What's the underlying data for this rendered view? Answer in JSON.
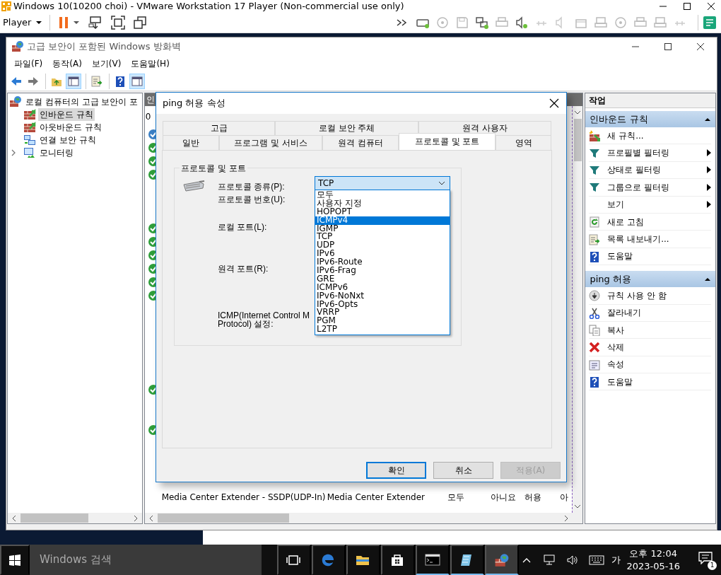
{
  "vmware": {
    "title": "Windows 10(10200 choi) - VMware Workstation 17 Player (Non-commercial use only)",
    "player_menu": "Player"
  },
  "mmc": {
    "title": "고급 보안이 포함된 Windows 방화벽",
    "menu": [
      "파일(F)",
      "동작(A)",
      "보기(V)",
      "도움말(H)"
    ],
    "toolbar": [
      {
        "pressed": false
      },
      {
        "pressed": false
      },
      {
        "pressed": false
      },
      {
        "pressed": true
      },
      {
        "pressed": false
      },
      {
        "pressed": false
      },
      {
        "pressed": true
      }
    ],
    "tree": {
      "label": "로컬 컴퓨터의 고급 보안이 포",
      "children": [
        {
          "label": "인바운드 규칙",
          "selected": true,
          "expandable": false
        },
        {
          "label": "아웃바운드 규칙",
          "selected": false,
          "expandable": false
        },
        {
          "label": "연결 보안 규칙",
          "selected": false,
          "expandable": false
        },
        {
          "label": "모니터링",
          "selected": false,
          "expandable": true
        }
      ]
    },
    "rules": {
      "title": "인",
      "column_1": "0",
      "rows": [
        {
          "kind": "secure"
        },
        {
          "kind": "allowed"
        },
        {
          "kind": "allowed"
        },
        {
          "kind": "allowed"
        },
        {
          "kind": "disabled"
        },
        {
          "kind": "disabled"
        },
        {
          "kind": "disabled"
        },
        {
          "kind": "allowed"
        },
        {
          "kind": "allowed"
        },
        {
          "kind": "allowed"
        },
        {
          "kind": "allowed"
        },
        {
          "kind": "allowed"
        },
        {
          "kind": "allowed"
        },
        {
          "kind": "disabled"
        },
        {
          "kind": "disabled"
        },
        {
          "kind": "disabled"
        },
        {
          "kind": "disabled"
        },
        {
          "kind": "disabled"
        },
        {
          "kind": "disabled"
        },
        {
          "kind": "allowed"
        },
        {
          "kind": "disabled"
        },
        {
          "kind": "disabled"
        },
        {
          "kind": "allowed"
        },
        {
          "kind": "disabled"
        },
        {
          "kind": "disabled"
        },
        {
          "kind": "disabled"
        },
        {
          "kind": "disabled"
        },
        {
          "kind": "disabled",
          "cells": [
            "Media Center Extender - SSDP(UDP-In)",
            "Media Center Extender",
            "모두",
            "아니요",
            "허용",
            "아"
          ]
        },
        {
          "kind": "disabled"
        }
      ]
    },
    "actions": {
      "header": "작업",
      "sections": [
        {
          "title": "인바운드 규칙",
          "items": [
            {
              "label": "새 규칙...",
              "submenu": false
            },
            {
              "label": "프로필별 필터링",
              "submenu": true
            },
            {
              "label": "상태로 필터링",
              "submenu": true
            },
            {
              "label": "그룹으로 필터링",
              "submenu": true
            },
            {
              "label": "보기",
              "submenu": true
            },
            {
              "label": "새로 고침",
              "submenu": false
            },
            {
              "label": "목록 내보내기...",
              "submenu": false
            },
            {
              "label": "도움말",
              "submenu": false
            }
          ]
        },
        {
          "title": "ping 허용",
          "items": [
            {
              "label": "규칙 사용 안 함",
              "submenu": false
            },
            {
              "label": "잘라내기",
              "submenu": false
            },
            {
              "label": "복사",
              "submenu": false
            },
            {
              "label": "삭제",
              "submenu": false
            },
            {
              "label": "속성",
              "submenu": false
            },
            {
              "label": "도움말",
              "submenu": false
            }
          ]
        }
      ]
    }
  },
  "dialog": {
    "title": "ping 허용 속성",
    "tabs_back": [
      {
        "label": "고급",
        "selected": false
      },
      {
        "label": "로컬 보안 주체",
        "selected": false
      },
      {
        "label": "원격 사용자",
        "selected": false
      }
    ],
    "tabs_front": [
      {
        "label": "일반",
        "selected": false
      },
      {
        "label": "프로그램 및 서비스",
        "selected": false
      },
      {
        "label": "원격 컴퓨터",
        "selected": false
      },
      {
        "label": "프로토콜 및 포트",
        "selected": true
      },
      {
        "label": "영역",
        "selected": false
      }
    ],
    "group": "프로토콜 및 포트",
    "labels": [
      "프로토콜 종류(P):",
      "프로토콜 번호(U):",
      "로컬 포트(L):",
      "원격 포트(R):"
    ],
    "icmp_label": [
      "ICMP(Internet Control M",
      "Protocol) 설정:"
    ],
    "protocol_value": "TCP",
    "options": [
      {
        "label": "모두",
        "selected": false
      },
      {
        "label": "사용자 지정",
        "selected": false
      },
      {
        "label": "HOPOPT",
        "selected": false
      },
      {
        "label": "ICMPv4",
        "selected": true
      },
      {
        "label": "IGMP",
        "selected": false
      },
      {
        "label": "TCP",
        "selected": false
      },
      {
        "label": "UDP",
        "selected": false
      },
      {
        "label": "IPv6",
        "selected": false
      },
      {
        "label": "IPv6-Route",
        "selected": false
      },
      {
        "label": "IPv6-Frag",
        "selected": false
      },
      {
        "label": "GRE",
        "selected": false
      },
      {
        "label": "ICMPv6",
        "selected": false
      },
      {
        "label": "IPv6-NoNxt",
        "selected": false
      },
      {
        "label": "IPv6-Opts",
        "selected": false
      },
      {
        "label": "VRRP",
        "selected": false
      },
      {
        "label": "PGM",
        "selected": false
      },
      {
        "label": "L2TP",
        "selected": false
      }
    ],
    "buttons": [
      {
        "label": "확인",
        "default": true,
        "disabled": false
      },
      {
        "label": "취소",
        "default": false,
        "disabled": false
      },
      {
        "label": "적용(A)",
        "default": false,
        "disabled": true
      }
    ]
  },
  "taskbar": {
    "search_placeholder": "Windows 검색",
    "apps": [
      {
        "open": false,
        "active": false
      },
      {
        "open": false,
        "active": false
      },
      {
        "open": false,
        "active": false
      },
      {
        "open": false,
        "active": false
      },
      {
        "open": true,
        "active": false
      },
      {
        "open": true,
        "active": false
      },
      {
        "open": true,
        "active": true
      }
    ],
    "ime": "가",
    "time": "오후 12:04",
    "date": "2023-05-16",
    "notification_count": "1"
  }
}
